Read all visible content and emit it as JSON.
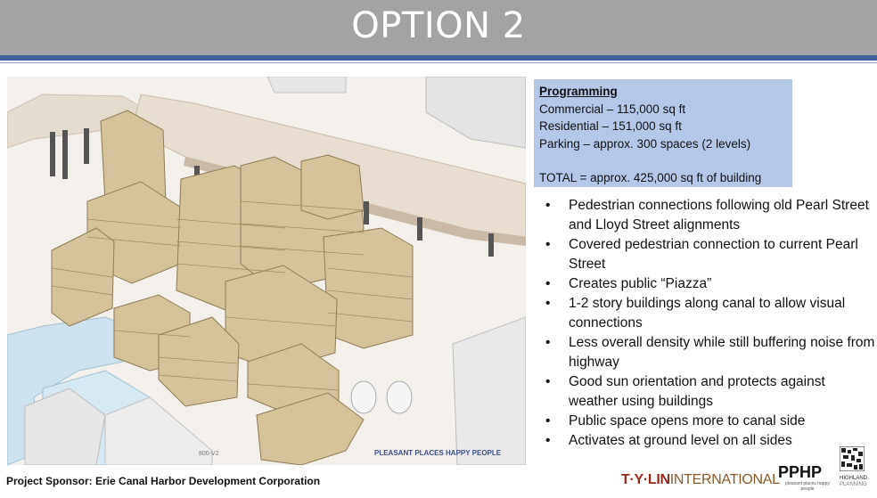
{
  "slide": {
    "title": "OPTION 2"
  },
  "rendering": {
    "plaza_caption": "PLEASANT PLACES HAPPY PEOPLE",
    "view_label": "800-V2"
  },
  "programming": {
    "heading": "Programming",
    "lines": [
      "Commercial – 115,000 sq ft",
      "Residential – 151,000 sq ft",
      "Parking – approx. 300 spaces (2 levels)"
    ],
    "total": "TOTAL = approx. 425,000 sq ft of building"
  },
  "bullets": [
    "Pedestrian connections following old Pearl Street and Lloyd Street alignments",
    "Covered pedestrian connection to current Pearl Street",
    "Creates public “Piazza”",
    "1-2 story buildings along canal to allow visual connections",
    "Less overall density while still buffering noise from highway",
    "Good sun orientation and protects against weather using buildings",
    "Public space opens more to canal side",
    "Activates at ground level on all sides"
  ],
  "footer": {
    "sponsor": "Project Sponsor:  Erie Canal Harbor Development Corporation",
    "tylin_bold": "T·Y·LIN",
    "tylin_rest": "INTERNATIONAL",
    "pphp": "PPHP",
    "pphp_tagline": "pleasant places happy people",
    "highland": "HIGHLAND",
    "highland_sub": "PLANNING"
  },
  "colors": {
    "title_bar": "#a3a3a3",
    "rule": "#3f5f99",
    "program_box": "#b5c7e7",
    "building": "#d4c39a",
    "canal": "#cfe3ef"
  }
}
